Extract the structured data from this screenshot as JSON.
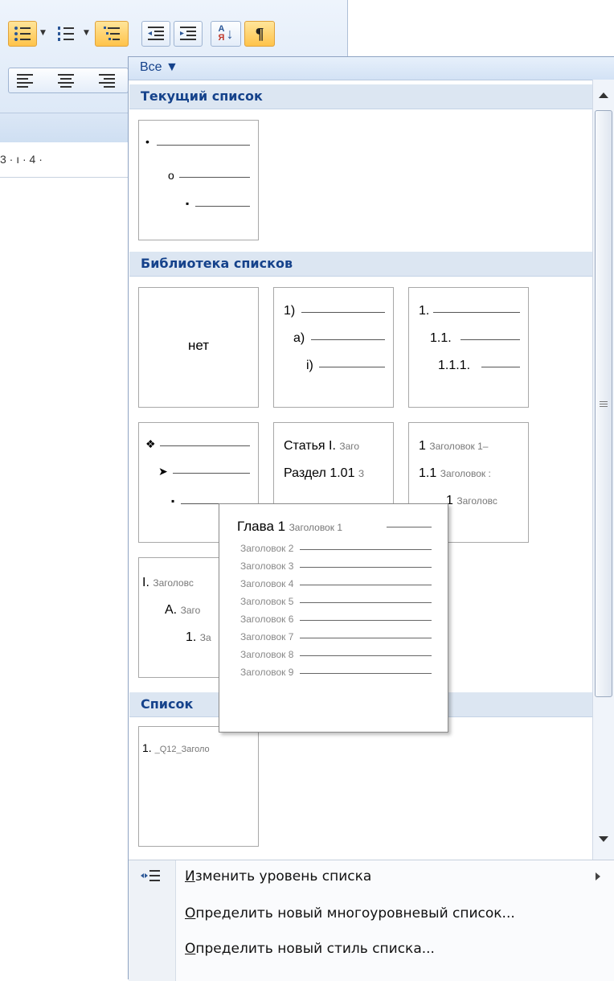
{
  "ribbon": {
    "buttons": [
      {
        "name": "bullets-button",
        "icon": "bullets-icon",
        "active": true
      },
      {
        "name": "numbering-button",
        "icon": "numbering-icon",
        "active": false
      },
      {
        "name": "multilevel-list-button",
        "icon": "multilevel-list-icon",
        "active": true
      },
      {
        "name": "decrease-indent-button",
        "icon": "decrease-indent-icon",
        "active": false
      },
      {
        "name": "increase-indent-button",
        "icon": "increase-indent-icon",
        "active": false
      },
      {
        "name": "sort-button",
        "icon": "sort-icon",
        "label": "А\nЯ",
        "active": false
      },
      {
        "name": "show-marks-button",
        "icon": "pilcrow-icon",
        "label": "¶",
        "active": true
      }
    ],
    "sort_label_a": "А",
    "sort_label_b": "Я",
    "pilcrow": "¶",
    "ruler_text": "3 · ı · 4 ·"
  },
  "panel": {
    "filter_label": "Все ▼",
    "sections": {
      "current": "Текущий список",
      "library": "Библиотека списков",
      "document": "Список"
    },
    "current_list": {
      "markers": [
        "•",
        "o",
        "▪"
      ]
    },
    "library": {
      "none_label": "нет",
      "numbered": {
        "markers": [
          "1)",
          "a)",
          "i)"
        ]
      },
      "decimal": {
        "markers": [
          "1.",
          "1.1.",
          "1.1.1."
        ]
      },
      "symbols": {
        "markers": [
          "❖",
          "➤",
          "▪"
        ]
      },
      "article": {
        "line1_bold": "Статья I.",
        "line1_gray": "Заго",
        "line2_bold": "Раздел 1.01",
        "line2_gray": "З"
      },
      "heading": {
        "line1_bold": "1",
        "line1_gray": "Заголовок 1–",
        "line2_bold": "1.1",
        "line2_gray": "Заголовок :",
        "line3_bold": "1",
        "line3_gray": "Заголовс"
      },
      "roman": {
        "line1_bold": "I.",
        "line1_gray": "Заголовс",
        "line2_bold": "A.",
        "line2_gray": "Заго",
        "line3_bold": "1.",
        "line3_gray": "За"
      }
    },
    "document_list": {
      "bold": "1.",
      "gray": "_Q12_Заголо"
    },
    "menu": {
      "change_level_key": "И",
      "change_level_rest": "зменить уровень списка",
      "define_multilevel_key": "О",
      "define_multilevel_rest": "пределить новый многоуровневый список...",
      "define_style_key": "О",
      "define_style_rest": "пределить новый стиль списка..."
    }
  },
  "popup": {
    "first_bold": "Глава 1",
    "first_gray": "Заголовок 1",
    "items": [
      "Заголовок 2",
      "Заголовок 3",
      "Заголовок 4",
      "Заголовок 5",
      "Заголовок 6",
      "Заголовок 7",
      "Заголовок 8",
      "Заголовок 9"
    ]
  }
}
